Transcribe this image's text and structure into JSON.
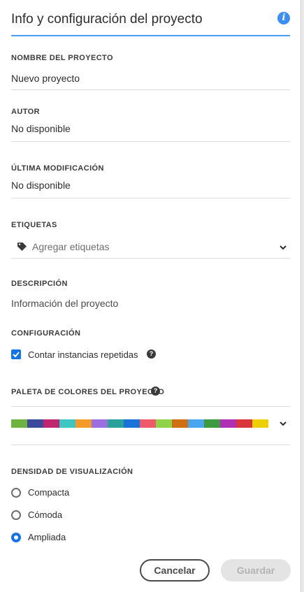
{
  "header": {
    "title": "Info y configuración del proyecto",
    "info_icon": "info-icon"
  },
  "fields": {
    "name": {
      "label": "NOMBRE DEL PROYECTO",
      "value": "Nuevo proyecto"
    },
    "author": {
      "label": "AUTOR",
      "value": "No disponible"
    },
    "modified": {
      "label": "ÚLTIMA MODIFICACIÓN",
      "value": "No disponible"
    },
    "tags": {
      "label": "ETIQUETAS",
      "placeholder": "Agregar etiquetas"
    },
    "description": {
      "label": "DESCRIPCIÓN",
      "placeholder": "Información del proyecto"
    }
  },
  "settings": {
    "label": "CONFIGURACIÓN",
    "count_repeated": {
      "label": "Contar instancias repetidas",
      "checked": true
    }
  },
  "palette": {
    "label": "PALETA DE COLORES DEL PROYECTO",
    "colors": [
      "#6fb33f",
      "#3b4a9b",
      "#c0256f",
      "#3ec6c2",
      "#f29b2a",
      "#9b6fe0",
      "#2aa19b",
      "#1a73d9",
      "#ee5a6a",
      "#8fd34a",
      "#d06f12",
      "#4ba6ef",
      "#3c9a41",
      "#b02fb5",
      "#d9363e",
      "#eecf00"
    ]
  },
  "density": {
    "label": "DENSIDAD DE VISUALIZACIÓN",
    "options": [
      {
        "label": "Compacta",
        "selected": false
      },
      {
        "label": "Cómoda",
        "selected": false
      },
      {
        "label": "Ampliada",
        "selected": true
      }
    ]
  },
  "buttons": {
    "cancel": "Cancelar",
    "save": "Guardar"
  },
  "accent": "#1473e6"
}
